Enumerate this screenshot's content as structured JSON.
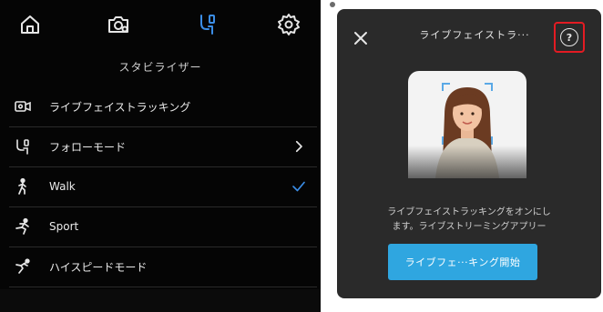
{
  "top_bar": {
    "icons": [
      "home-icon",
      "camera-settings-icon",
      "stabilizer-icon",
      "settings-gear-icon"
    ],
    "active_color": "#3b8de6"
  },
  "section_title": "スタビライザー",
  "menu": [
    {
      "label": "ライブフェイストラッキング",
      "icon": "face-tracking-icon",
      "trail": ""
    },
    {
      "label": "フォローモード",
      "icon": "follow-mode-icon",
      "trail": "chevron-right-icon"
    },
    {
      "label": "Walk",
      "icon": "walk-icon",
      "trail": "checkmark-icon"
    },
    {
      "label": "Sport",
      "icon": "sport-icon",
      "trail": ""
    },
    {
      "label": "ハイスピードモード",
      "icon": "high-speed-icon",
      "trail": ""
    }
  ],
  "help_panel": {
    "title": "ライブフェイストラ···",
    "help_highlight_color": "#e31b23",
    "description_line1": "ライブフェイストラッキングをオンにし",
    "description_line2": "ます。ライブストリーミングアプリー",
    "cta_label": "ライブフェ···キング開始",
    "cta_color": "#2fa6e0"
  }
}
